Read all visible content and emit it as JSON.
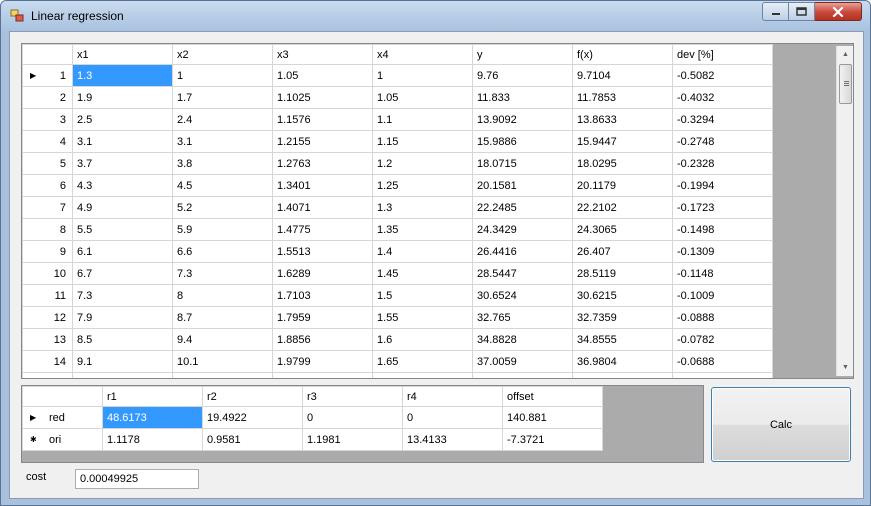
{
  "window": {
    "title": "Linear regression"
  },
  "main_grid": {
    "columns": [
      "x1",
      "x2",
      "x3",
      "x4",
      "y",
      "f(x)",
      "dev [%]"
    ],
    "rows": [
      {
        "index": "1",
        "cells": [
          "1.3",
          "1",
          "1.05",
          "1",
          "9.76",
          "9.7104",
          "-0.5082"
        ]
      },
      {
        "index": "2",
        "cells": [
          "1.9",
          "1.7",
          "1.1025",
          "1.05",
          "11.833",
          "11.7853",
          "-0.4032"
        ]
      },
      {
        "index": "3",
        "cells": [
          "2.5",
          "2.4",
          "1.1576",
          "1.1",
          "13.9092",
          "13.8633",
          "-0.3294"
        ]
      },
      {
        "index": "4",
        "cells": [
          "3.1",
          "3.1",
          "1.2155",
          "1.15",
          "15.9886",
          "15.9447",
          "-0.2748"
        ]
      },
      {
        "index": "5",
        "cells": [
          "3.7",
          "3.8",
          "1.2763",
          "1.2",
          "18.0715",
          "18.0295",
          "-0.2328"
        ]
      },
      {
        "index": "6",
        "cells": [
          "4.3",
          "4.5",
          "1.3401",
          "1.25",
          "20.1581",
          "20.1179",
          "-0.1994"
        ]
      },
      {
        "index": "7",
        "cells": [
          "4.9",
          "5.2",
          "1.4071",
          "1.3",
          "22.2485",
          "22.2102",
          "-0.1723"
        ]
      },
      {
        "index": "8",
        "cells": [
          "5.5",
          "5.9",
          "1.4775",
          "1.35",
          "24.3429",
          "24.3065",
          "-0.1498"
        ]
      },
      {
        "index": "9",
        "cells": [
          "6.1",
          "6.6",
          "1.5513",
          "1.4",
          "26.4416",
          "26.407",
          "-0.1309"
        ]
      },
      {
        "index": "10",
        "cells": [
          "6.7",
          "7.3",
          "1.6289",
          "1.45",
          "28.5447",
          "28.5119",
          "-0.1148"
        ]
      },
      {
        "index": "11",
        "cells": [
          "7.3",
          "8",
          "1.7103",
          "1.5",
          "30.6524",
          "30.6215",
          "-0.1009"
        ]
      },
      {
        "index": "12",
        "cells": [
          "7.9",
          "8.7",
          "1.7959",
          "1.55",
          "32.765",
          "32.7359",
          "-0.0888"
        ]
      },
      {
        "index": "13",
        "cells": [
          "8.5",
          "9.4",
          "1.8856",
          "1.6",
          "34.8828",
          "34.8555",
          "-0.0782"
        ]
      },
      {
        "index": "14",
        "cells": [
          "9.1",
          "10.1",
          "1.9799",
          "1.65",
          "37.0059",
          "36.9804",
          "-0.0688"
        ]
      },
      {
        "index": "",
        "cells": [
          "",
          "",
          "",
          "",
          "",
          "",
          ""
        ]
      }
    ]
  },
  "result_grid": {
    "columns": [
      "r1",
      "r2",
      "r3",
      "r4",
      "offset"
    ],
    "rows": [
      {
        "label": "red",
        "cells": [
          "48.6173",
          "19.4922",
          "0",
          "0",
          "140.881"
        ]
      },
      {
        "label": "ori",
        "cells": [
          "1.1178",
          "0.9581",
          "1.1981",
          "13.4133",
          "-7.3721"
        ]
      }
    ]
  },
  "calc_button": {
    "label": "Calc"
  },
  "cost": {
    "label": "cost",
    "value": "0.00049925"
  },
  "markers": {
    "current": "▶",
    "new": "✱"
  },
  "colors": {
    "selection": "#3399ff",
    "grid_background": "#ababab",
    "close_button": "#c7473a"
  }
}
